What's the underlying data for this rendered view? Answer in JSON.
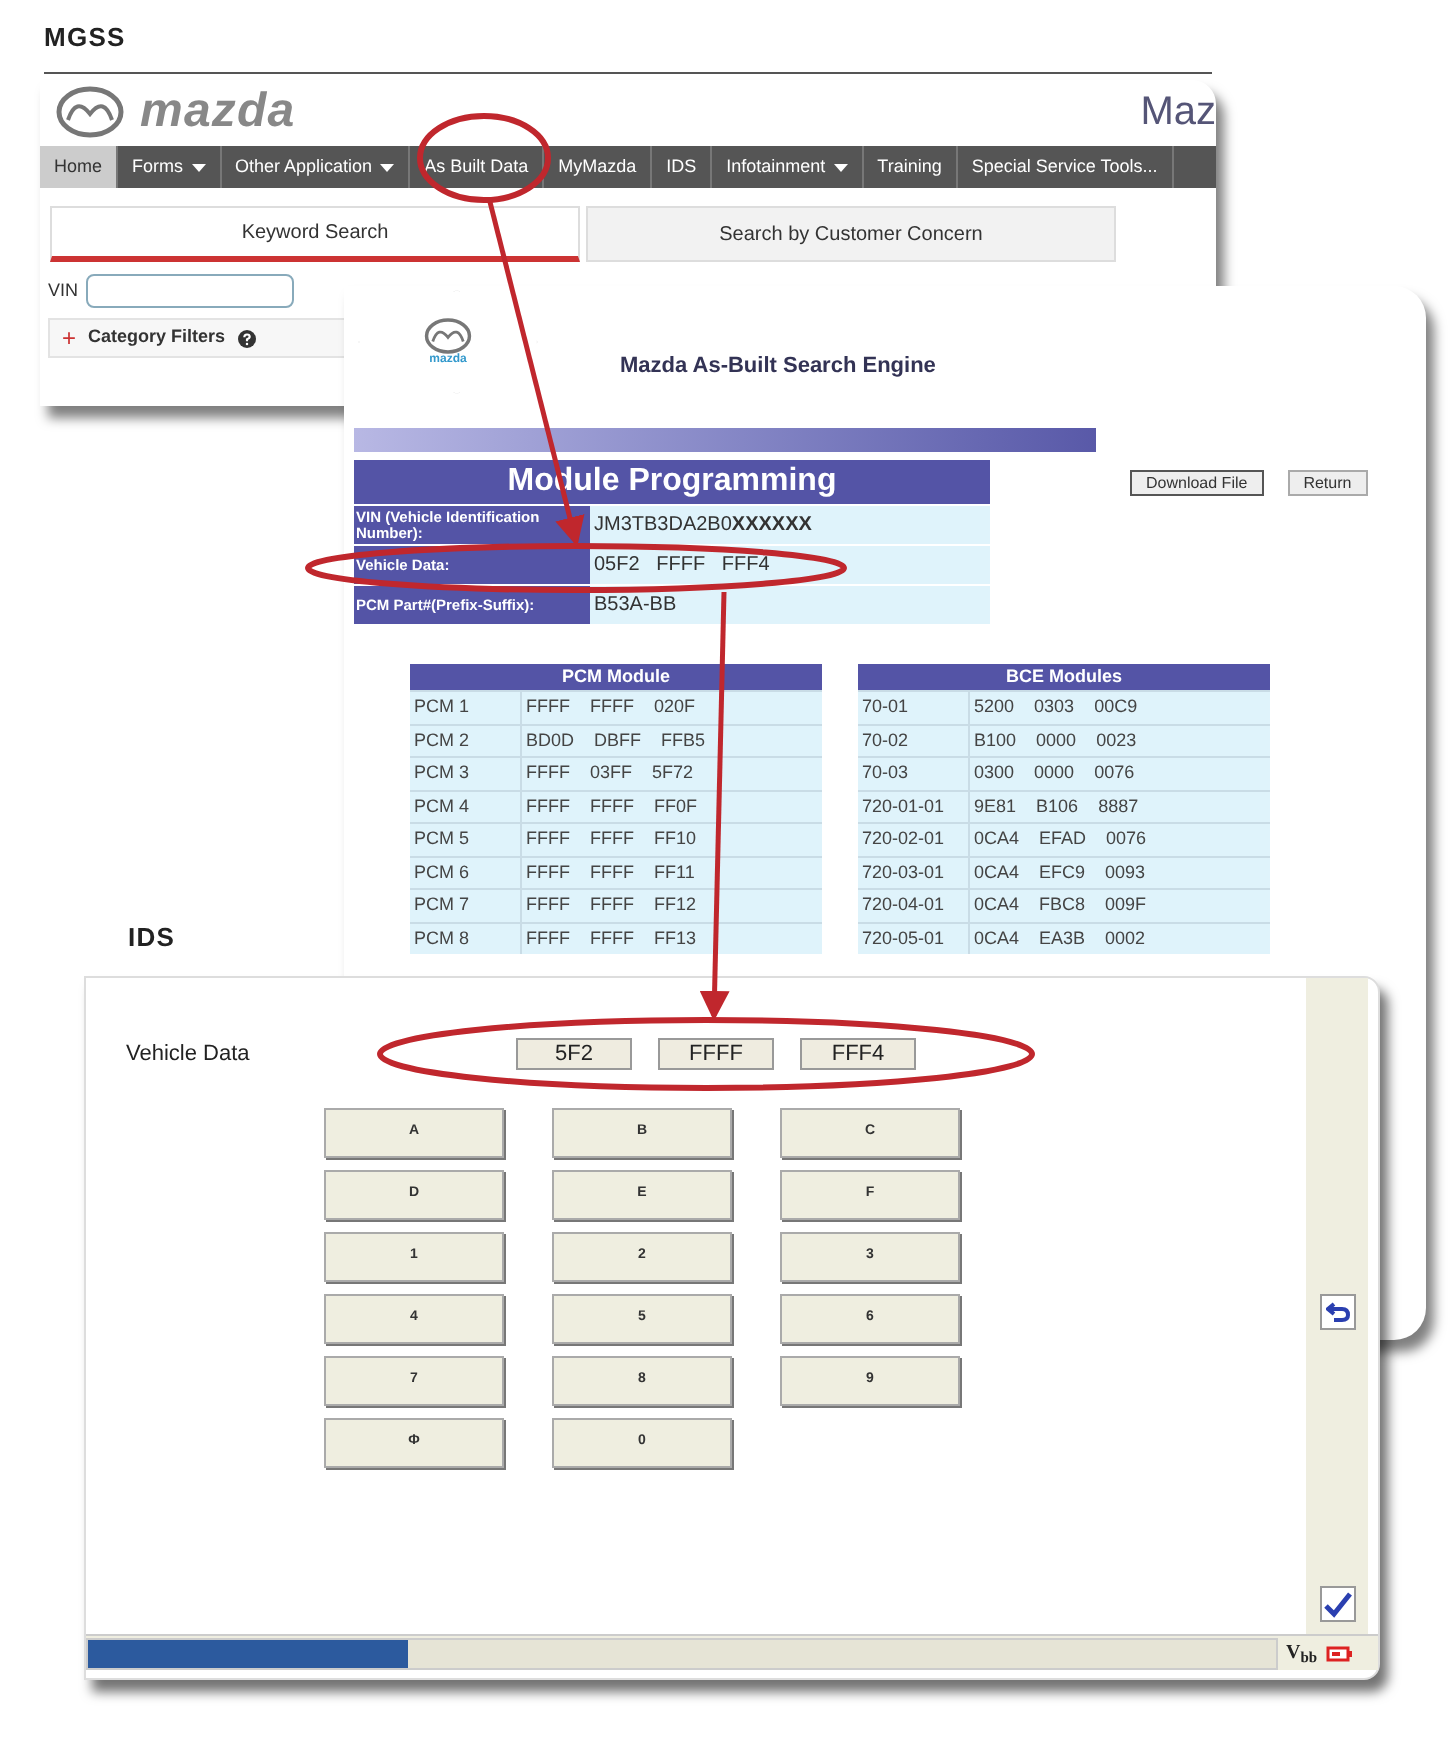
{
  "mgss_label": "MGSS",
  "mgss": {
    "brand": "mazda",
    "heading": "Maz",
    "nav": [
      {
        "label": "Home",
        "selected": true,
        "has_menu": false
      },
      {
        "label": "Forms",
        "selected": false,
        "has_menu": true
      },
      {
        "label": "Other Application",
        "selected": false,
        "has_menu": true
      },
      {
        "label": "As Built Data",
        "selected": false,
        "has_menu": false
      },
      {
        "label": "MyMazda",
        "selected": false,
        "has_menu": false
      },
      {
        "label": "IDS",
        "selected": false,
        "has_menu": false
      },
      {
        "label": "Infotainment",
        "selected": false,
        "has_menu": true
      },
      {
        "label": "Training",
        "selected": false,
        "has_menu": false
      },
      {
        "label": "Special Service Tools...",
        "selected": false,
        "has_menu": false
      }
    ],
    "tabs": [
      {
        "label": "Keyword Search",
        "selected": true
      },
      {
        "label": "Search by Customer Concern",
        "selected": false
      }
    ],
    "vin_label": "VIN",
    "filters": {
      "icon": "+",
      "label": "Category Filters"
    }
  },
  "asbuilt": {
    "brand": "mazda",
    "title": "Mazda As-Built Search Engine",
    "heading": "Module Programming",
    "info": [
      {
        "label": "VIN (Vehicle Identification Number):",
        "value": "JM3TB3DA2B0**XXXXXX**"
      },
      {
        "label": "Vehicle Data:",
        "value": "05F2   FFFF   FFF4"
      },
      {
        "label": "PCM Part#(Prefix-Suffix):",
        "value": "B53A-BB"
      }
    ],
    "buttons": [
      "Download File",
      "Return"
    ],
    "tables": [
      {
        "title": "PCM Module",
        "rows": [
          {
            "module": "PCM 1",
            "values": [
              "FFFF",
              "FFFF",
              "020F"
            ]
          },
          {
            "module": "PCM 2",
            "values": [
              "BD0D",
              "DBFF",
              "FFB5"
            ]
          },
          {
            "module": "PCM 3",
            "values": [
              "FFFF",
              "03FF",
              "5F72"
            ]
          },
          {
            "module": "PCM 4",
            "values": [
              "FFFF",
              "FFFF",
              "FF0F"
            ]
          },
          {
            "module": "PCM 5",
            "values": [
              "FFFF",
              "FFFF",
              "FF10"
            ]
          },
          {
            "module": "PCM 6",
            "values": [
              "FFFF",
              "FFFF",
              "FF11"
            ]
          },
          {
            "module": "PCM 7",
            "values": [
              "FFFF",
              "FFFF",
              "FF12"
            ]
          },
          {
            "module": "PCM 8",
            "values": [
              "FFFF",
              "FFFF",
              "FF13"
            ]
          }
        ]
      },
      {
        "title": "BCE Modules",
        "rows": [
          {
            "module": "70-01",
            "values": [
              "5200",
              "0303",
              "00C9"
            ]
          },
          {
            "module": "70-02",
            "values": [
              "B100",
              "0000",
              "0023"
            ]
          },
          {
            "module": "70-03",
            "values": [
              "0300",
              "0000",
              "0076"
            ]
          },
          {
            "module": "720-01-01",
            "values": [
              "9E81",
              "B106",
              "8887"
            ]
          },
          {
            "module": "720-02-01",
            "values": [
              "0CA4",
              "EFAD",
              "0076"
            ]
          },
          {
            "module": "720-03-01",
            "values": [
              "0CA4",
              "EFC9",
              "0093"
            ]
          },
          {
            "module": "720-04-01",
            "values": [
              "0CA4",
              "FBC8",
              "009F"
            ]
          },
          {
            "module": "720-05-01",
            "values": [
              "0CA4",
              "EA3B",
              "0002"
            ]
          }
        ]
      }
    ]
  },
  "ids_label": "IDS",
  "ids": {
    "vehicle_data_label": "Vehicle Data",
    "vehicle_data": [
      "5F2",
      "FFFF",
      "FFF4"
    ],
    "keys": [
      "A",
      "B",
      "C",
      "D",
      "E",
      "F",
      "1",
      "2",
      "3",
      "4",
      "5",
      "6",
      "7",
      "8",
      "9",
      "Φ",
      "0"
    ],
    "progress": {
      "level": 0.27
    },
    "voltage": "V$_{bb}$"
  }
}
